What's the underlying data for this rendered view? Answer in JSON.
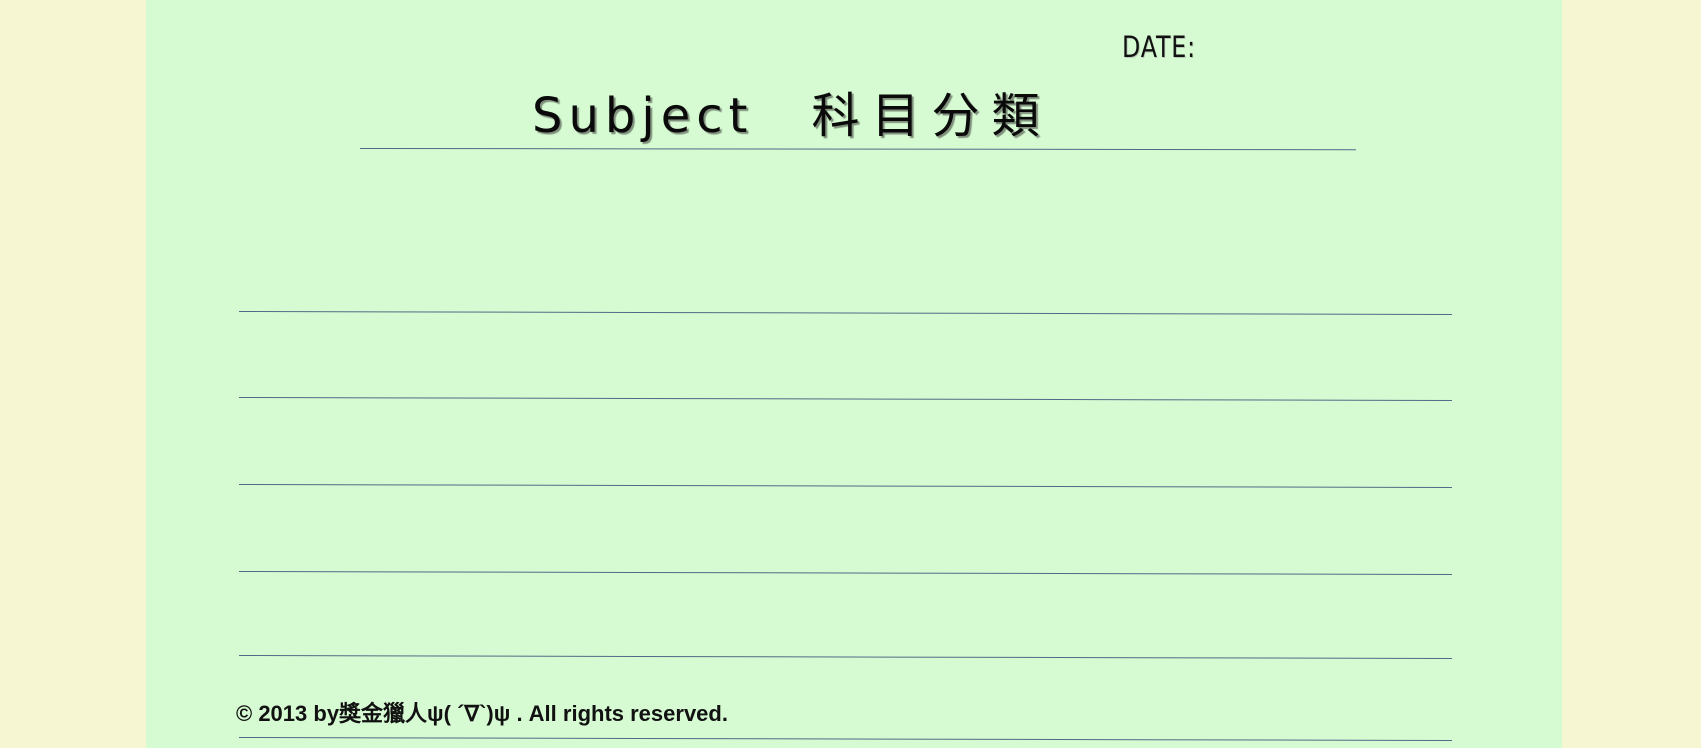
{
  "page": {
    "date_label": "DATE:",
    "title_en": "Subject",
    "title_zh": "科目分類",
    "copyright": "© 2013 by獎金獵人ψ( ´∇`)ψ . All rights reserved."
  },
  "writing_lines_count": 5,
  "colors": {
    "background": "#f6f7d2",
    "sheet": "#d6fbd2",
    "rule": "#4f6b86",
    "text": "#111111"
  }
}
